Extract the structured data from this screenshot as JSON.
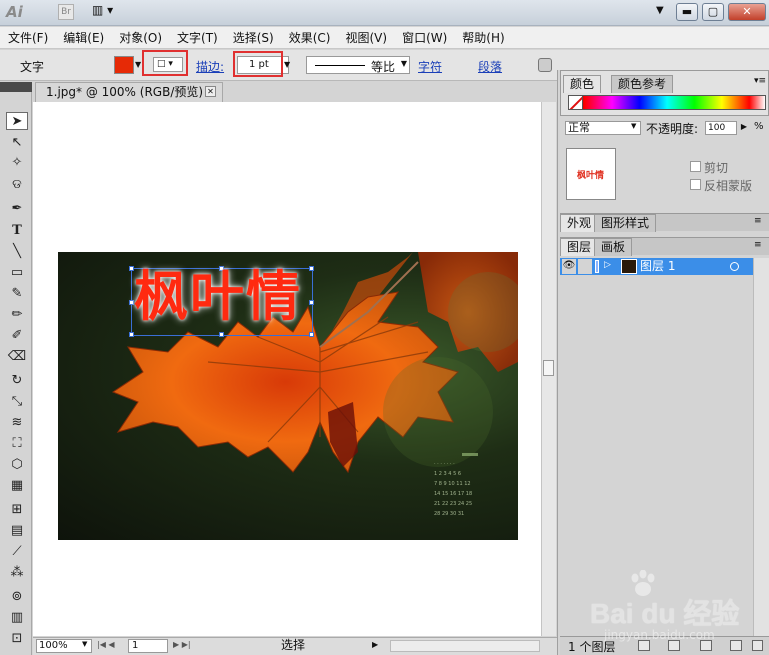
{
  "title_bar": {
    "logo": "Ai",
    "bridge_label": "Br",
    "arrange_icon": "arrange-documents-icon",
    "window_controls": [
      "minimize",
      "restore",
      "close"
    ]
  },
  "menu": [
    "文件(F)",
    "编辑(E)",
    "对象(O)",
    "文字(T)",
    "选择(S)",
    "效果(C)",
    "视图(V)",
    "窗口(W)",
    "帮助(H)"
  ],
  "control_bar": {
    "tool_label": "文字",
    "fill_color": "#e62a06",
    "stroke_link": "描边:",
    "stroke_weight": "1 pt",
    "profile_label": "等比",
    "char_link": "字符",
    "para_link": "段落",
    "highlight_color": "#e03030"
  },
  "document": {
    "tab_title": "1.jpg* @ 100% (RGB/预览)",
    "art_text": "枫叶情",
    "text_color": "#ff2a10"
  },
  "status_bar": {
    "zoom": "100%",
    "page": "1",
    "status": "选择"
  },
  "color_panel": {
    "tabs": [
      "颜色",
      "颜色参考"
    ]
  },
  "transparency_panel": {
    "blend_mode": "正常",
    "opacity_label": "不透明度:",
    "opacity_value": "100",
    "opacity_unit": "%",
    "clip_label": "剪切",
    "invert_label": "反相蒙版",
    "thumb_text": "枫叶情"
  },
  "appearance_panel": {
    "tabs": [
      "外观",
      "图形样式"
    ]
  },
  "layers_panel": {
    "tabs": [
      "图层",
      "画板"
    ],
    "layer_name": "图层 1",
    "layer_count": "1 个图层",
    "selection_color": "#3b8ee8"
  },
  "watermark": {
    "text": "Bai du 经验",
    "url": "jingyan.baidu.com"
  }
}
